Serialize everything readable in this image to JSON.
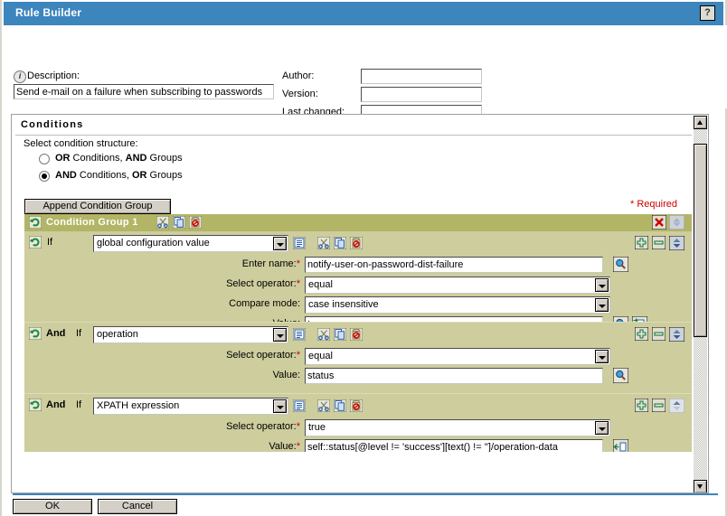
{
  "window": {
    "title": "Rule Builder",
    "help_label": "?",
    "accent_color": "#3d85bd",
    "group_header_color": "#b3b566",
    "group_body_color": "#cdcd9e",
    "required_color": "#cc0000"
  },
  "meta": {
    "description_label": "Description:",
    "description_value": "Send e-mail on a failure when subscribing to passwords",
    "description_placeholder": "",
    "author_label": "Author:",
    "author_value": "",
    "version_label": "Version:",
    "version_value": "",
    "last_changed_label": "Last changed:",
    "last_changed_value": ""
  },
  "conditions": {
    "section_title": "Conditions",
    "structure_label": "Select condition structure:",
    "structure_options": [
      {
        "bold1": "OR",
        "text1": " Conditions, ",
        "bold2": "AND",
        "text2": " Groups",
        "selected": false
      },
      {
        "bold1": "AND",
        "text1": " Conditions, ",
        "bold2": "OR",
        "text2": " Groups",
        "selected": true
      }
    ],
    "append_group_label": "Append Condition Group",
    "required_note": "* Required",
    "group": {
      "name": "Condition Group 1",
      "items": [
        {
          "connector": "",
          "if_label": "If",
          "type": "global configuration value",
          "rows": [
            {
              "label": "Enter name:",
              "required": true,
              "kind": "text",
              "value": "notify-user-on-password-dist-failure",
              "tools": [
                "lookup-icon"
              ]
            },
            {
              "label": "Select operator:",
              "required": true,
              "kind": "select",
              "value": "equal",
              "tools": []
            },
            {
              "label": "Compare mode:",
              "required": false,
              "kind": "select",
              "value": "case insensitive",
              "tools": []
            },
            {
              "label": "Value:",
              "required": false,
              "kind": "text",
              "value": "true",
              "tools": [
                "lookup-icon",
                "argument-builder-icon"
              ]
            }
          ]
        },
        {
          "connector": "And",
          "if_label": "If",
          "type": "operation",
          "rows": [
            {
              "label": "Select operator:",
              "required": true,
              "kind": "select",
              "value": "equal",
              "tools": []
            },
            {
              "label": "Value:",
              "required": false,
              "kind": "text",
              "value": "status",
              "tools": [
                "lookup-icon"
              ]
            }
          ]
        },
        {
          "connector": "And",
          "if_label": "If",
          "type": "XPATH expression",
          "rows": [
            {
              "label": "Select operator:",
              "required": true,
              "kind": "select",
              "value": "true",
              "tools": []
            },
            {
              "label": "Value:",
              "required": true,
              "kind": "text",
              "value": "self::status[@level != 'success'][text() != '']/operation-data",
              "tools": [
                "xpath-builder-icon"
              ]
            }
          ]
        }
      ]
    }
  },
  "footer": {
    "ok_label": "OK",
    "cancel_label": "Cancel"
  }
}
